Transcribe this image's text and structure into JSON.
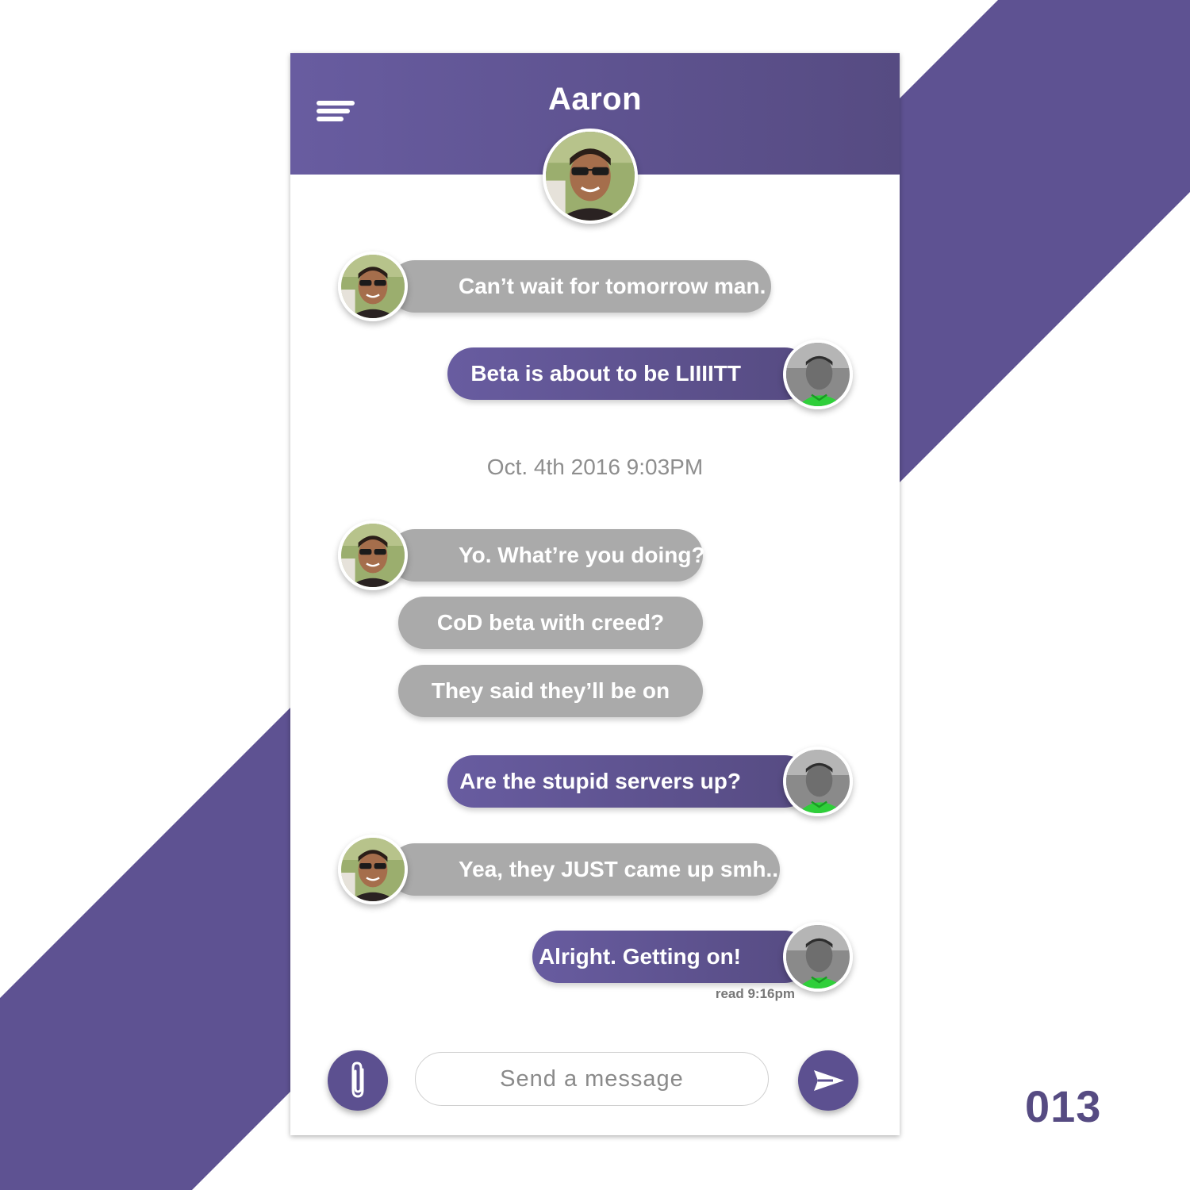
{
  "header": {
    "title": "Aaron"
  },
  "messages": [
    {
      "side": "in",
      "text": "Can’t wait for tomorrow man."
    },
    {
      "side": "out",
      "text": "Beta is about to be LIIIITT"
    },
    {
      "side": "in",
      "text": "Yo. What’re you doing?"
    },
    {
      "side": "in",
      "text": "CoD beta with creed?"
    },
    {
      "side": "in",
      "text": "They said they’ll be on"
    },
    {
      "side": "out",
      "text": "Are the stupid servers up?"
    },
    {
      "side": "in",
      "text": "Yea, they JUST came up smh.."
    },
    {
      "side": "out",
      "text": "Alright. Getting on!"
    }
  ],
  "timestamp": "Oct. 4th 2016 9:03PM",
  "read_receipt": "read 9:16pm",
  "composer": {
    "placeholder": "Send a message"
  },
  "shot_number": "013",
  "colors": {
    "brand_purple": "#5c5090",
    "incoming_bubble": "#aaaaaa",
    "background": "#ffffff"
  },
  "icons": {
    "menu": "menu-icon",
    "attach": "paperclip-icon",
    "send": "send-icon"
  }
}
